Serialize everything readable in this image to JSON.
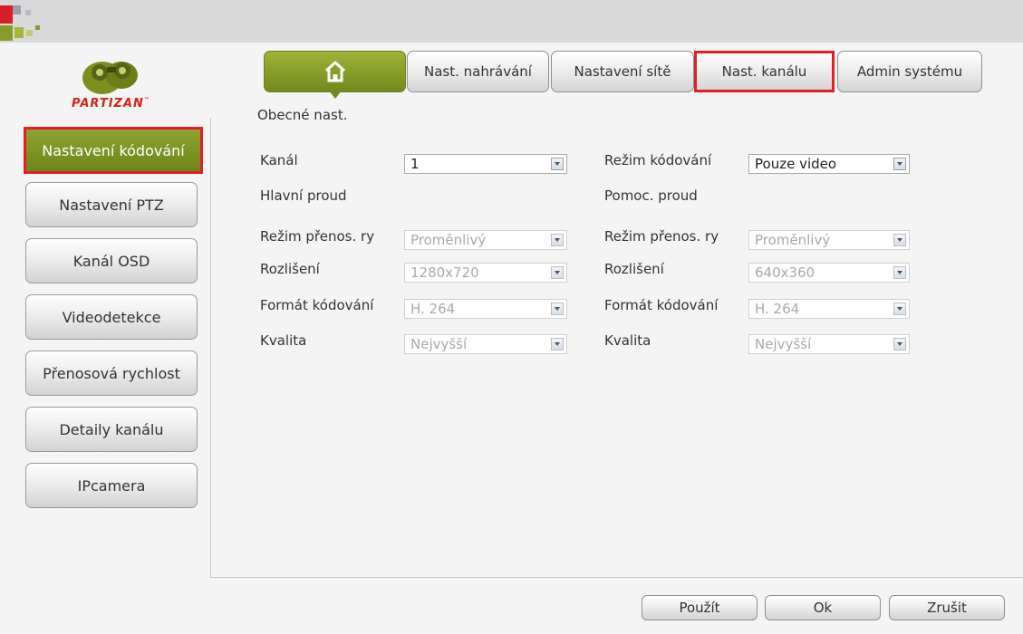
{
  "brand": {
    "name": "PARTIZAN",
    "tm": "™"
  },
  "tabs": {
    "home_icon": "home-icon",
    "items": [
      "Nast. nahrávání",
      "Nastavení sítě",
      "Nast. kanálu",
      "Admin systému"
    ],
    "active": "Nast. kanálu"
  },
  "subtitle": "Obecné nast.",
  "sidebar": {
    "items": [
      "Nastavení kódování",
      "Nastavení PTZ",
      "Kanál OSD",
      "Videodetekce",
      "Přenosová rychlost",
      "Detaily kanálu",
      "IPcamera"
    ],
    "active": "Nastavení kódování"
  },
  "form": {
    "channel_label": "Kanál",
    "channel_value": "1",
    "encode_mode_label": "Režim kódování",
    "encode_mode_value": "Pouze video",
    "main_stream": {
      "heading": "Hlavní proud",
      "bitrate_mode_label": "Režim přenos. ry",
      "bitrate_mode_value": "Proměnlivý",
      "resolution_label": "Rozlišení",
      "resolution_value": "1280x720",
      "format_label": "Formát kódování",
      "format_value": "H. 264",
      "quality_label": "Kvalita",
      "quality_value": "Nejvyšší"
    },
    "sub_stream": {
      "heading": "Pomoc. proud",
      "bitrate_mode_label": "Režim přenos. ry",
      "bitrate_mode_value": "Proměnlivý",
      "resolution_label": "Rozlišení",
      "resolution_value": "640x360",
      "format_label": "Formát kódování",
      "format_value": "H. 264",
      "quality_label": "Kvalita",
      "quality_value": "Nejvyšší"
    }
  },
  "footer": {
    "apply": "Použít",
    "ok": "Ok",
    "cancel": "Zrušit"
  },
  "colors": {
    "accent_green": "#7d9422",
    "highlight_red": "#e01f27",
    "brand_red": "#d3261a"
  }
}
